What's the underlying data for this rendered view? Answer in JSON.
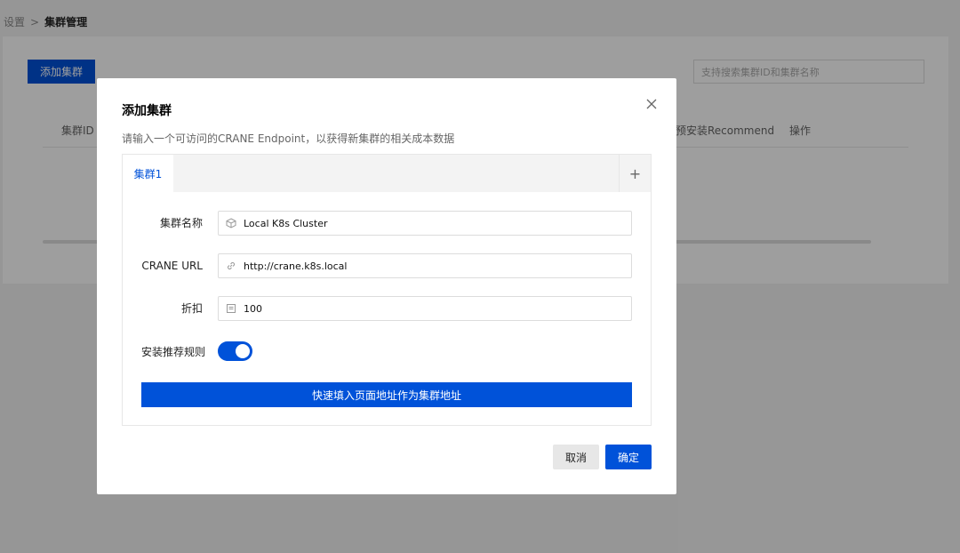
{
  "breadcrumb": {
    "parent": "设置",
    "separator": ">",
    "current": "集群管理"
  },
  "background": {
    "add_button": "添加集群",
    "search_placeholder": "支持搜索集群ID和集群名称",
    "columns": {
      "cluster_id": "集群ID",
      "recommend": "预安装Recommend",
      "actions": "操作"
    }
  },
  "modal": {
    "title": "添加集群",
    "close_icon": "close-icon",
    "description": "请输入一个可访问的CRANE Endpoint，以获得新集群的相关成本数据",
    "tabs": [
      {
        "label": "集群1",
        "active": true
      }
    ],
    "add_tab_label": "+",
    "form": {
      "cluster_name": {
        "label": "集群名称",
        "value": "Local K8s Cluster",
        "icon": "cube-icon"
      },
      "crane_url": {
        "label": "CRANE URL",
        "value": "http://crane.k8s.local",
        "icon": "link-icon"
      },
      "discount": {
        "label": "折扣",
        "value": "100",
        "icon": "document-icon"
      },
      "install_rules": {
        "label": "安装推荐规则",
        "enabled": true
      }
    },
    "fill_button": "快速填入页面地址作为集群地址",
    "cancel_button": "取消",
    "confirm_button": "确定"
  },
  "colors": {
    "primary": "#0052d9",
    "overlay": "rgba(0,0,0,0.38)"
  }
}
